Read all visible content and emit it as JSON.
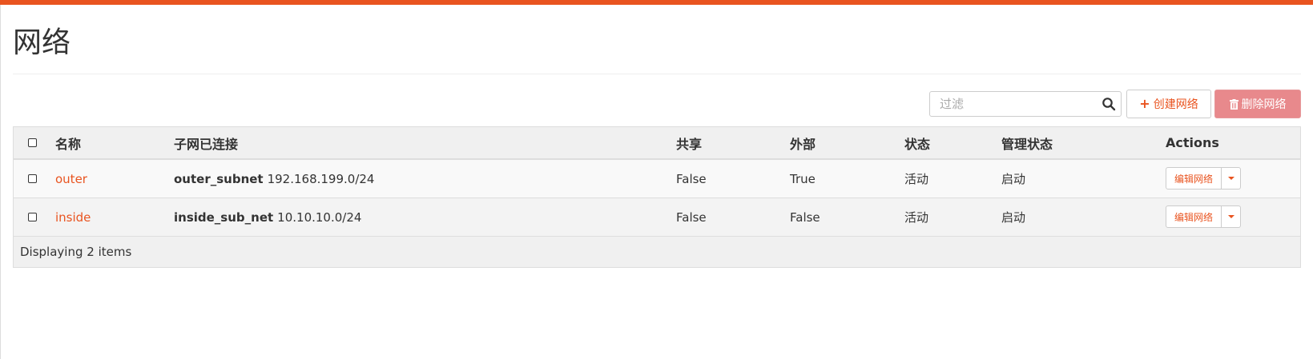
{
  "page": {
    "title": "网络",
    "accent_color": "#E95420"
  },
  "toolbar": {
    "filter_placeholder": "过滤",
    "search_icon": "search-icon",
    "create_label": "创建网络",
    "create_icon": "plus-icon",
    "delete_label": "删除网络",
    "delete_icon": "trash-icon"
  },
  "table": {
    "columns": [
      "名称",
      "子网已连接",
      "共享",
      "外部",
      "状态",
      "管理状态",
      "Actions"
    ],
    "rows": [
      {
        "name": "outer",
        "subnet_name": "outer_subnet",
        "subnet_cidr": "192.168.199.0/24",
        "shared": "False",
        "external": "True",
        "status": "活动",
        "admin_state": "启动",
        "action_label": "编辑网络"
      },
      {
        "name": "inside",
        "subnet_name": "inside_sub_net",
        "subnet_cidr": "10.10.10.0/24",
        "shared": "False",
        "external": "False",
        "status": "活动",
        "admin_state": "启动",
        "action_label": "编辑网络"
      }
    ],
    "footer": "Displaying 2 items"
  }
}
